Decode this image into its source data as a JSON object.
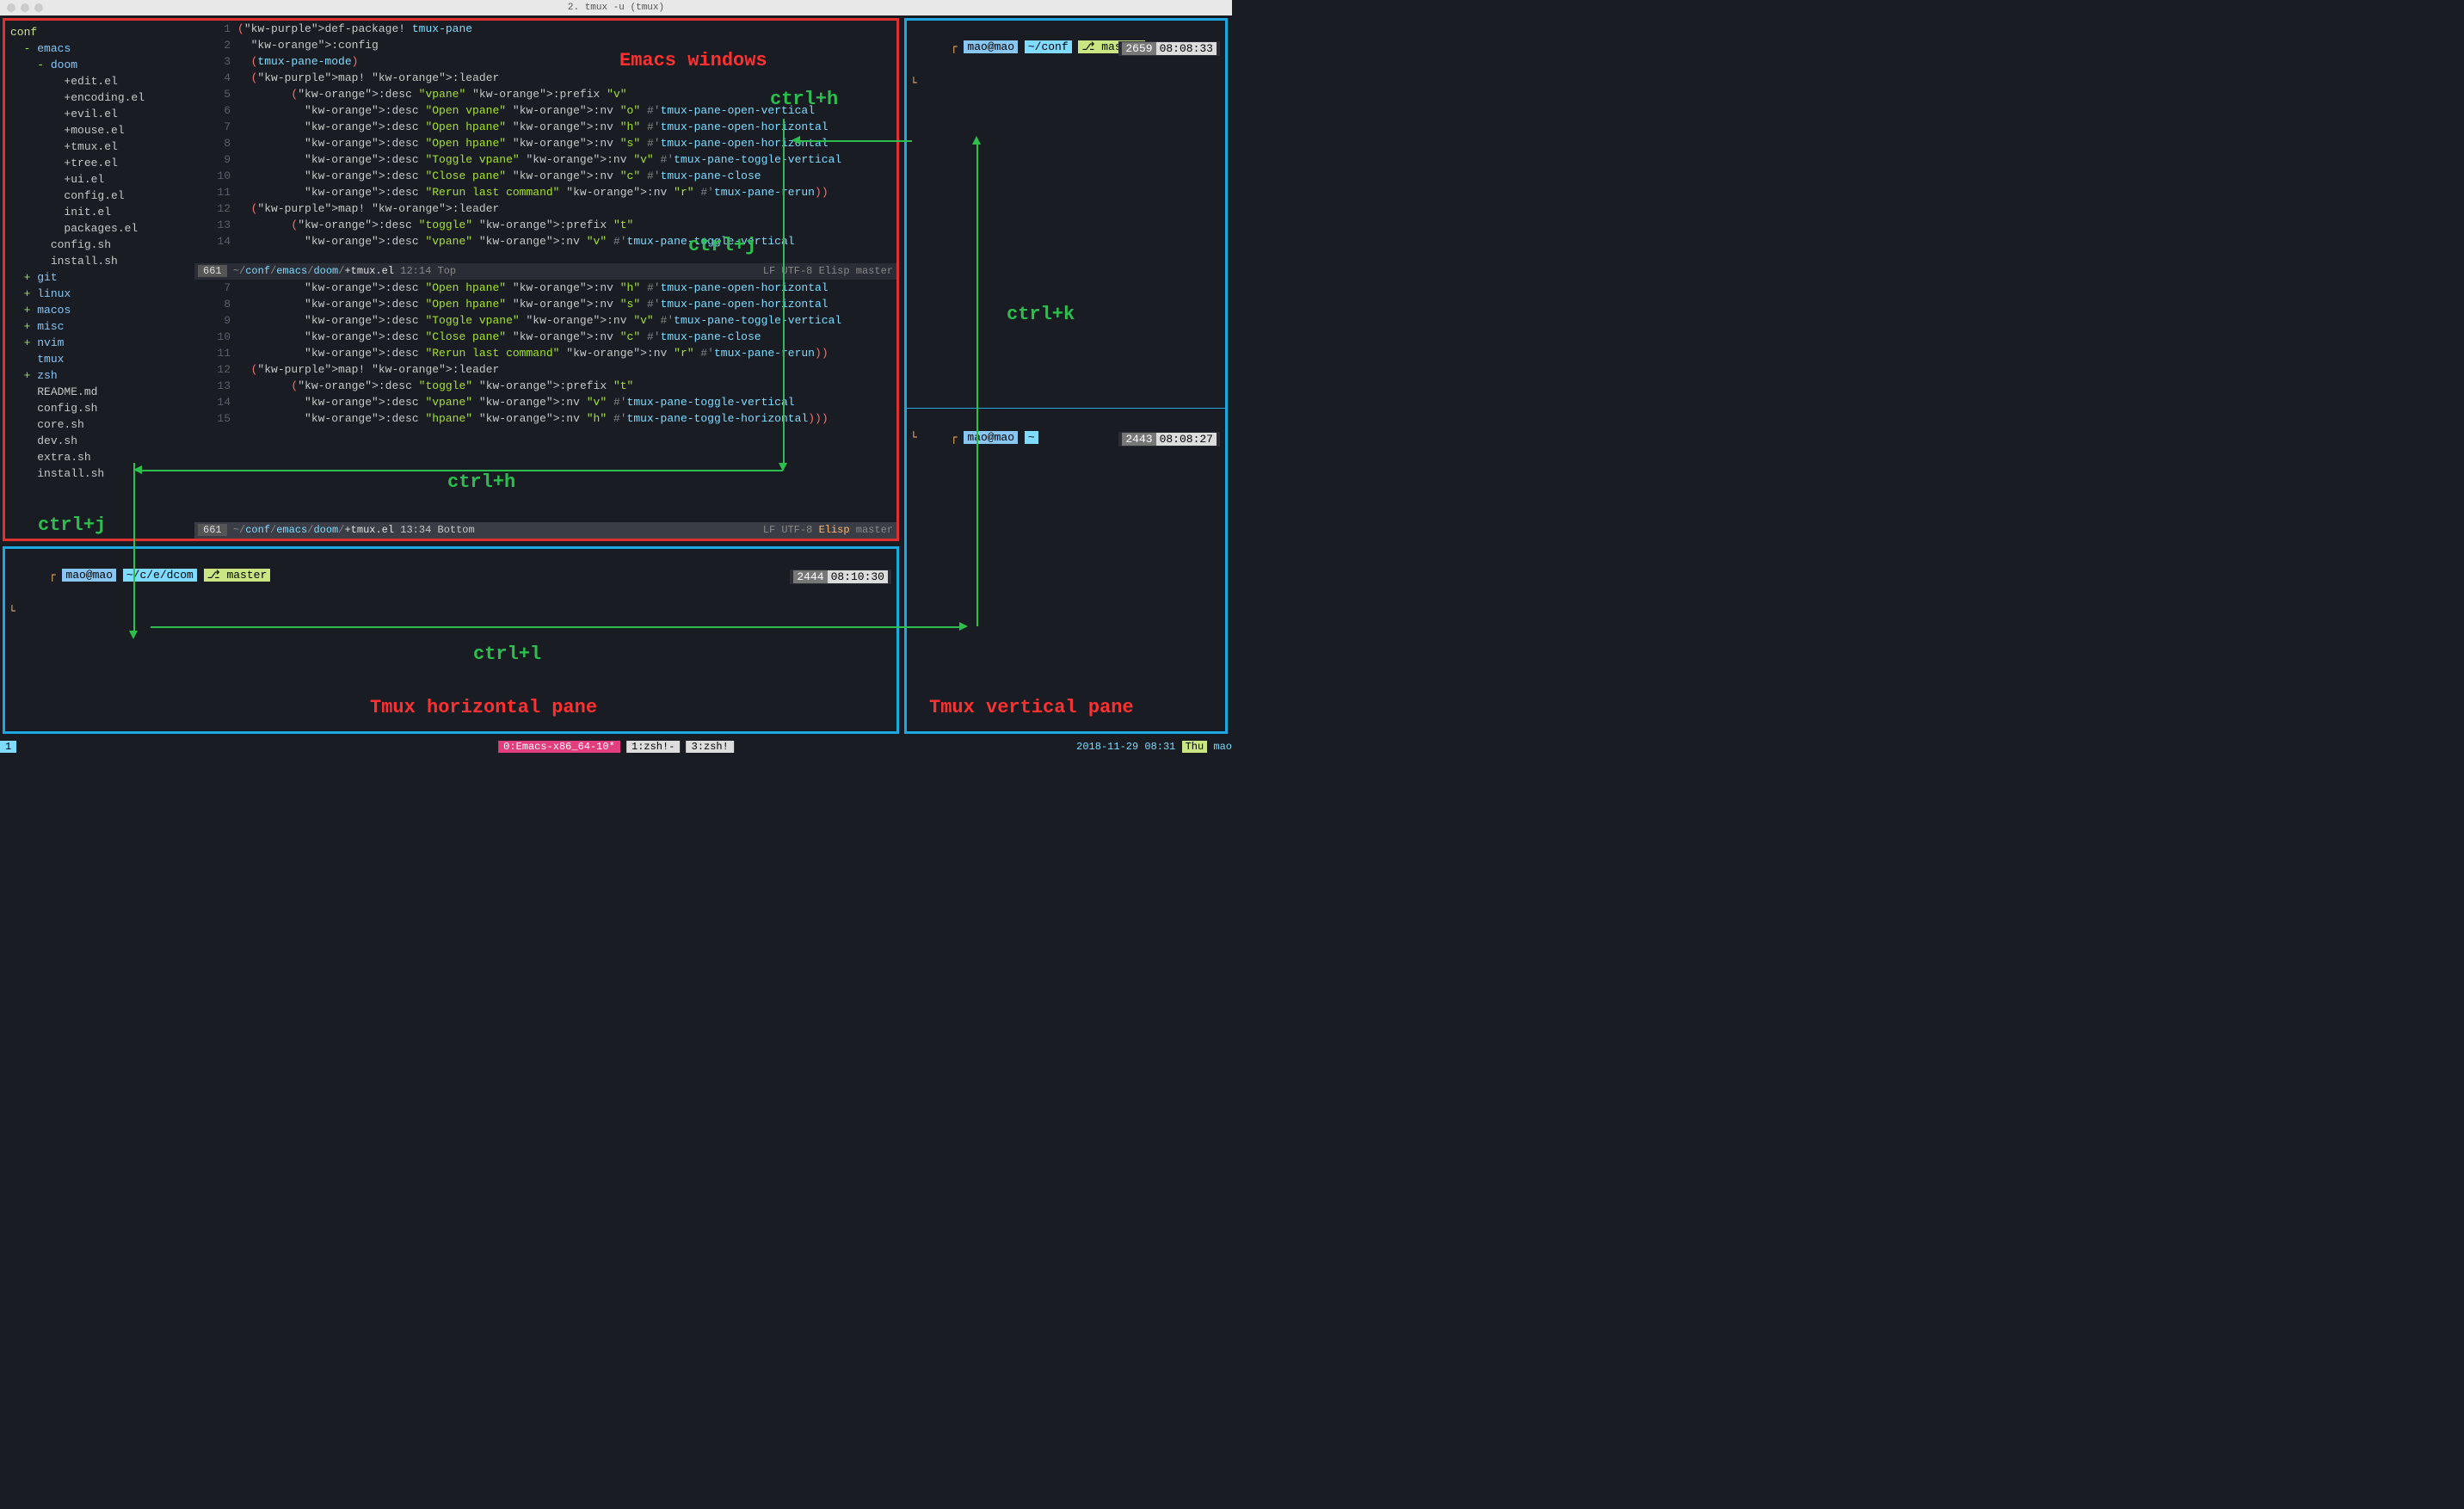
{
  "window": {
    "title": "2. tmux -u (tmux)"
  },
  "tree": {
    "title": "conf",
    "lines": [
      {
        "indent": 0,
        "exp": "-",
        "name": "emacs",
        "type": "dir"
      },
      {
        "indent": 1,
        "exp": "-",
        "name": "doom",
        "type": "dir"
      },
      {
        "indent": 2,
        "exp": "",
        "name": "+edit.el",
        "type": "file"
      },
      {
        "indent": 2,
        "exp": "",
        "name": "+encoding.el",
        "type": "file"
      },
      {
        "indent": 2,
        "exp": "",
        "name": "+evil.el",
        "type": "file"
      },
      {
        "indent": 2,
        "exp": "",
        "name": "+mouse.el",
        "type": "file"
      },
      {
        "indent": 2,
        "exp": "",
        "name": "+tmux.el",
        "type": "file"
      },
      {
        "indent": 2,
        "exp": "",
        "name": "+tree.el",
        "type": "file"
      },
      {
        "indent": 2,
        "exp": "",
        "name": "+ui.el",
        "type": "file"
      },
      {
        "indent": 2,
        "exp": "",
        "name": "config.el",
        "type": "file"
      },
      {
        "indent": 2,
        "exp": "",
        "name": "init.el",
        "type": "file"
      },
      {
        "indent": 2,
        "exp": "",
        "name": "packages.el",
        "type": "file"
      },
      {
        "indent": 1,
        "exp": "",
        "name": "config.sh",
        "type": "file"
      },
      {
        "indent": 1,
        "exp": "",
        "name": "install.sh",
        "type": "file"
      },
      {
        "indent": 0,
        "exp": "+",
        "name": "git",
        "type": "dir"
      },
      {
        "indent": 0,
        "exp": "+",
        "name": "linux",
        "type": "dir"
      },
      {
        "indent": 0,
        "exp": "+",
        "name": "macos",
        "type": "dir"
      },
      {
        "indent": 0,
        "exp": "+",
        "name": "misc",
        "type": "dir"
      },
      {
        "indent": 0,
        "exp": "+",
        "name": "nvim",
        "type": "dir"
      },
      {
        "indent": 0,
        "exp": "",
        "name": "tmux",
        "type": "dir"
      },
      {
        "indent": 0,
        "exp": "+",
        "name": "zsh",
        "type": "dir"
      },
      {
        "indent": 0,
        "exp": "",
        "name": "README.md",
        "type": "file"
      },
      {
        "indent": 0,
        "exp": "",
        "name": "config.sh",
        "type": "file"
      },
      {
        "indent": 0,
        "exp": "",
        "name": "core.sh",
        "type": "file"
      },
      {
        "indent": 0,
        "exp": "",
        "name": "dev.sh",
        "type": "file"
      },
      {
        "indent": 0,
        "exp": "",
        "name": "extra.sh",
        "type": "file"
      },
      {
        "indent": 0,
        "exp": "",
        "name": "install.sh",
        "type": "file"
      }
    ]
  },
  "code_top": {
    "start": 1,
    "lines": [
      "(def-package! tmux-pane",
      "  :config",
      "  (tmux-pane-mode)",
      "  (map! :leader",
      "        (:desc \"vpane\" :prefix \"v\"",
      "          :desc \"Open vpane\" :nv \"o\" #'tmux-pane-open-vertical",
      "          :desc \"Open hpane\" :nv \"h\" #'tmux-pane-open-horizontal",
      "          :desc \"Open hpane\" :nv \"s\" #'tmux-pane-open-horizontal",
      "          :desc \"Toggle vpane\" :nv \"v\" #'tmux-pane-toggle-vertical",
      "          :desc \"Close pane\" :nv \"c\" #'tmux-pane-close",
      "          :desc \"Rerun last command\" :nv \"r\" #'tmux-pane-rerun))",
      "  (map! :leader",
      "        (:desc \"toggle\" :prefix \"t\"",
      "          :desc \"vpane\" :nv \"v\" #'tmux-pane-toggle-vertical"
    ],
    "modeline_num": "661",
    "modeline_path": "~/conf/emacs/doom/+tmux.el",
    "modeline_pos": "12:14 Top",
    "modeline_right": "LF  UTF-8  Elisp   master"
  },
  "code_bot": {
    "start": 7,
    "lines": [
      "          :desc \"Open hpane\" :nv \"h\" #'tmux-pane-open-horizontal",
      "          :desc \"Open hpane\" :nv \"s\" #'tmux-pane-open-horizontal",
      "          :desc \"Toggle vpane\" :nv \"v\" #'tmux-pane-toggle-vertical",
      "          :desc \"Close pane\" :nv \"c\" #'tmux-pane-close",
      "          :desc \"Rerun last command\" :nv \"r\" #'tmux-pane-rerun))",
      "  (map! :leader",
      "        (:desc \"toggle\" :prefix \"t\"",
      "          :desc \"vpane\" :nv \"v\" #'tmux-pane-toggle-vertical",
      "          :desc \"hpane\" :nv \"h\" #'tmux-pane-toggle-horizontal)))"
    ],
    "cursor_line_index": 6,
    "modeline_num": "661",
    "modeline_path": "~/conf/emacs/doom/+tmux.el",
    "modeline_pos": "13:34 Bottom",
    "modeline_right": "LF  UTF-8  Elisp   master"
  },
  "bottom_shell": {
    "user": "mao@mao",
    "path": "~/c/e/dcom",
    "branch": "⎇ master",
    "hist": "2444",
    "time": "08:10:30"
  },
  "right_top_shell": {
    "user": "mao@mao",
    "path": "~/conf",
    "branch": "⎇ master",
    "hist": "2659",
    "time": "08:08:33"
  },
  "right_bot_shell": {
    "user": "mao@mao",
    "path": "~",
    "hist": "2443",
    "time": "08:08:27"
  },
  "statusbar": {
    "session": "1",
    "windows": [
      {
        "label": "0:Emacs-x86_64-10*",
        "active": true
      },
      {
        "label": "1:zsh!-",
        "active": false
      },
      {
        "label": "3:zsh!",
        "active": false
      }
    ],
    "date": "2018-11-29 08:31",
    "day": "Thu",
    "user": "mao"
  },
  "annotations": {
    "emacs_title": "Emacs windows",
    "ctrl_h": "ctrl+h",
    "ctrl_j": "ctrl+j",
    "ctrl_k": "ctrl+k",
    "ctrl_l": "ctrl+l",
    "tmux_h": "Tmux horizontal pane",
    "tmux_v": "Tmux vertical pane"
  }
}
